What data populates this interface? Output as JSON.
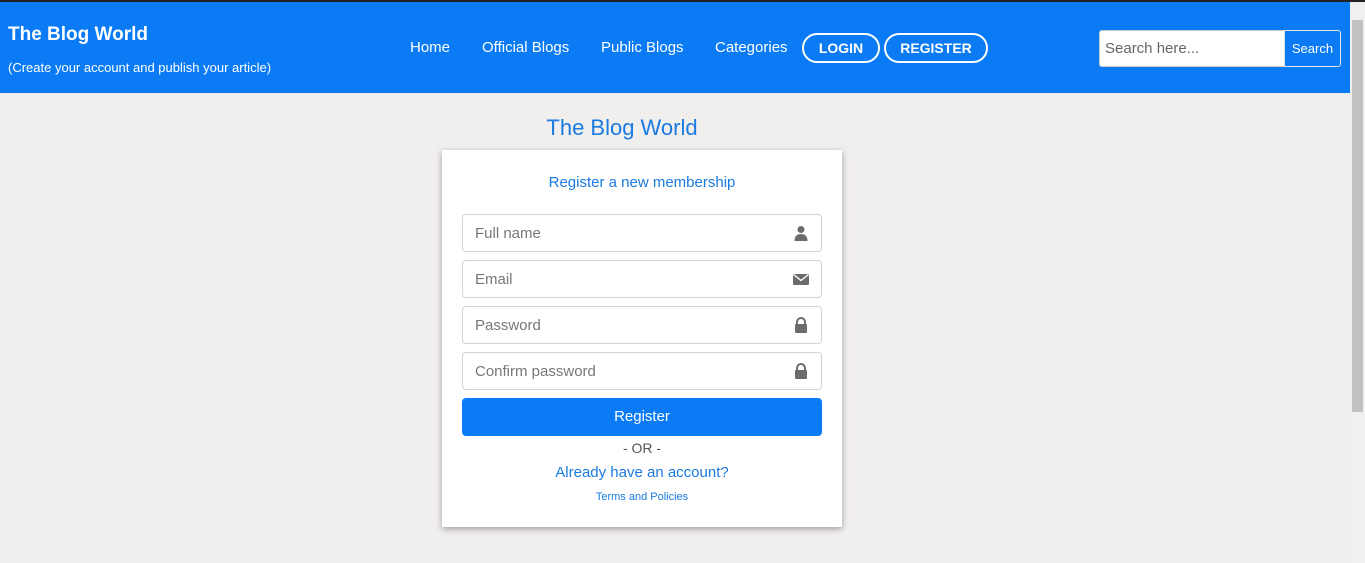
{
  "header": {
    "brand_title": "The Blog World",
    "brand_subtitle": "(Create your account and publish your article)",
    "nav": [
      "Home",
      "Official Blogs",
      "Public Blogs",
      "Categories"
    ],
    "login_label": "LOGIN",
    "register_label": "REGISTER",
    "search_placeholder": "Search here...",
    "search_button": "Search"
  },
  "main": {
    "page_title": "The Blog World",
    "card_message": "Register a new membership",
    "fields": {
      "full_name": {
        "placeholder": "Full name",
        "icon": "user-icon"
      },
      "email": {
        "placeholder": "Email",
        "icon": "envelope-icon"
      },
      "password": {
        "placeholder": "Password",
        "icon": "lock-icon"
      },
      "confirm_password": {
        "placeholder": "Confirm password",
        "icon": "lock-icon"
      }
    },
    "register_button": "Register",
    "or_text": "- OR -",
    "login_link": "Already have an account?",
    "terms_link": "Terms and Policies"
  },
  "colors": {
    "primary": "#0a7bf5",
    "link": "#1a7be0",
    "background": "#f1eeee"
  }
}
